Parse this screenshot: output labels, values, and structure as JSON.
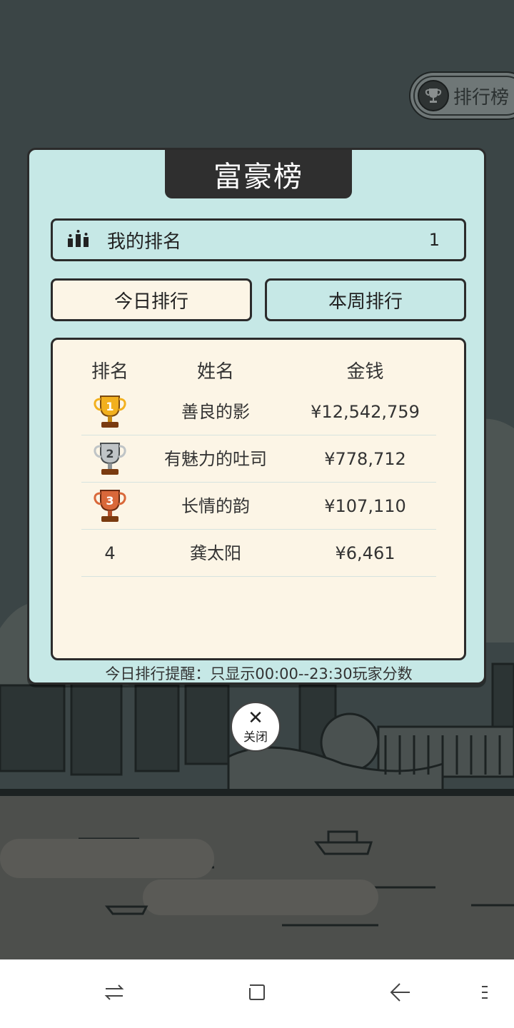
{
  "top_button": {
    "label": "排行榜",
    "icon": "trophy-icon"
  },
  "dialog": {
    "title": "富豪榜",
    "my_rank": {
      "label": "我的排名",
      "value": "1",
      "icon": "podium-icon"
    },
    "tabs": [
      {
        "label": "今日排行",
        "selected": true
      },
      {
        "label": "本周排行",
        "selected": false
      }
    ],
    "table": {
      "headers": [
        "排名",
        "姓名",
        "金钱"
      ],
      "rows": [
        {
          "rank": "1",
          "rank_icon": "gold-trophy-icon",
          "name": "善良的影",
          "money": "¥12,542,759"
        },
        {
          "rank": "2",
          "rank_icon": "silver-trophy-icon",
          "name": "有魅力的吐司",
          "money": "¥778,712"
        },
        {
          "rank": "3",
          "rank_icon": "bronze-trophy-icon",
          "name": "长情的韵",
          "money": "¥107,110"
        },
        {
          "rank": "4",
          "name": "龚太阳",
          "money": "¥6,461"
        }
      ]
    },
    "notice": "今日排行提醒：只显示00:00--23:30玩家分数"
  },
  "close_button": {
    "label": "关闭",
    "icon": "close-icon"
  },
  "navbar": {
    "icons": [
      "recent-apps-icon",
      "home-icon",
      "back-icon",
      "menu-icon"
    ]
  },
  "colors": {
    "dialog_bg": "#c6e8e6",
    "panel_bg": "#fcf5e6",
    "title_bg": "#2f2f2f",
    "gold": "#f2b01e",
    "silver": "#bfc4c6",
    "bronze": "#d9683a"
  }
}
